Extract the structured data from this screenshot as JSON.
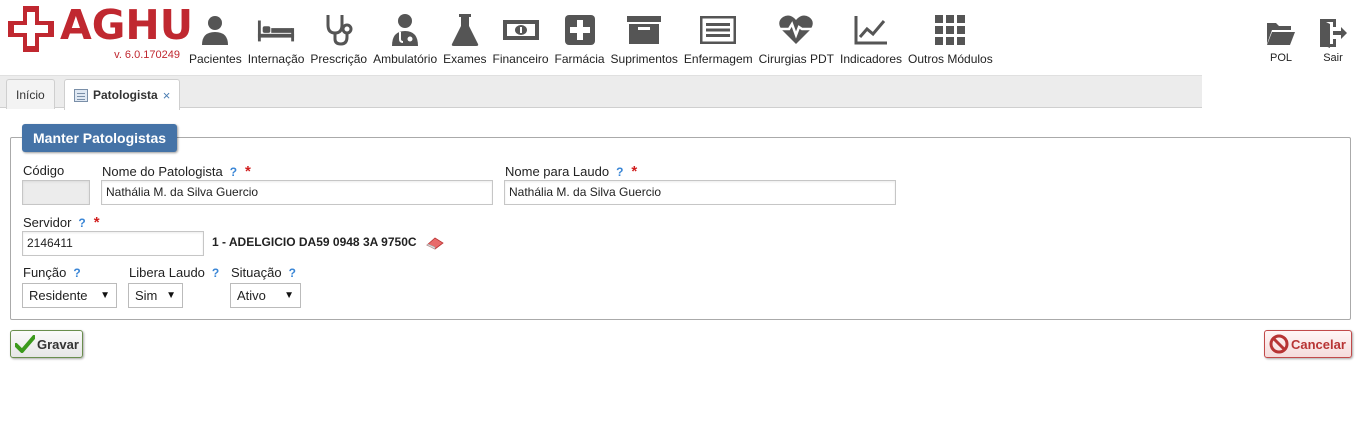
{
  "app": {
    "logo_text": "AGHU",
    "version": "v. 6.0.170249",
    "brand_color": "#c02830"
  },
  "modules": [
    {
      "label": "Pacientes",
      "icon": "person-icon"
    },
    {
      "label": "Internação",
      "icon": "bed-icon"
    },
    {
      "label": "Prescrição",
      "icon": "stethoscope-icon"
    },
    {
      "label": "Ambulatório",
      "icon": "doctor-icon"
    },
    {
      "label": "Exames",
      "icon": "flask-icon"
    },
    {
      "label": "Financeiro",
      "icon": "money-icon"
    },
    {
      "label": "Farmácia",
      "icon": "pharmacy-cross-icon"
    },
    {
      "label": "Suprimentos",
      "icon": "archive-box-icon"
    },
    {
      "label": "Enfermagem",
      "icon": "list-icon"
    },
    {
      "label": "Cirurgias PDT",
      "icon": "heartbeat-icon"
    },
    {
      "label": "Indicadores",
      "icon": "line-chart-icon"
    },
    {
      "label": "Outros Módulos",
      "icon": "grid-icon"
    }
  ],
  "right_actions": [
    {
      "label": "POL",
      "icon": "folder-open-icon"
    },
    {
      "label": "Sair",
      "icon": "exit-door-icon"
    }
  ],
  "tabs": {
    "home": "Início",
    "active": "Patologista",
    "close": "×"
  },
  "form": {
    "legend": "Manter Patologistas",
    "codigo": {
      "label": "Código",
      "value": ""
    },
    "nome_patologista": {
      "label": "Nome do Patologista",
      "value": "Nathália M. da Silva Guercio"
    },
    "nome_laudo": {
      "label": "Nome para Laudo",
      "value": "Nathália M. da Silva Guercio"
    },
    "servidor": {
      "label": "Servidor",
      "value": "2146411",
      "name": "1 - ADELGICIO DA59 0948 3A 9750C"
    },
    "funcao": {
      "label": "Função",
      "selected": "Residente"
    },
    "libera_laudo": {
      "label": "Libera Laudo",
      "selected": "Sim"
    },
    "situacao": {
      "label": "Situação",
      "selected": "Ativo"
    },
    "help_glyph": "?",
    "required_glyph": "*",
    "select_arrow": "▼"
  },
  "buttons": {
    "gravar": "Gravar",
    "cancelar": "Cancelar"
  },
  "colors": {
    "legend_bg": "#4573a7",
    "help": "#3a86d6",
    "required": "#d11e1e",
    "icon_gray": "#555555"
  }
}
